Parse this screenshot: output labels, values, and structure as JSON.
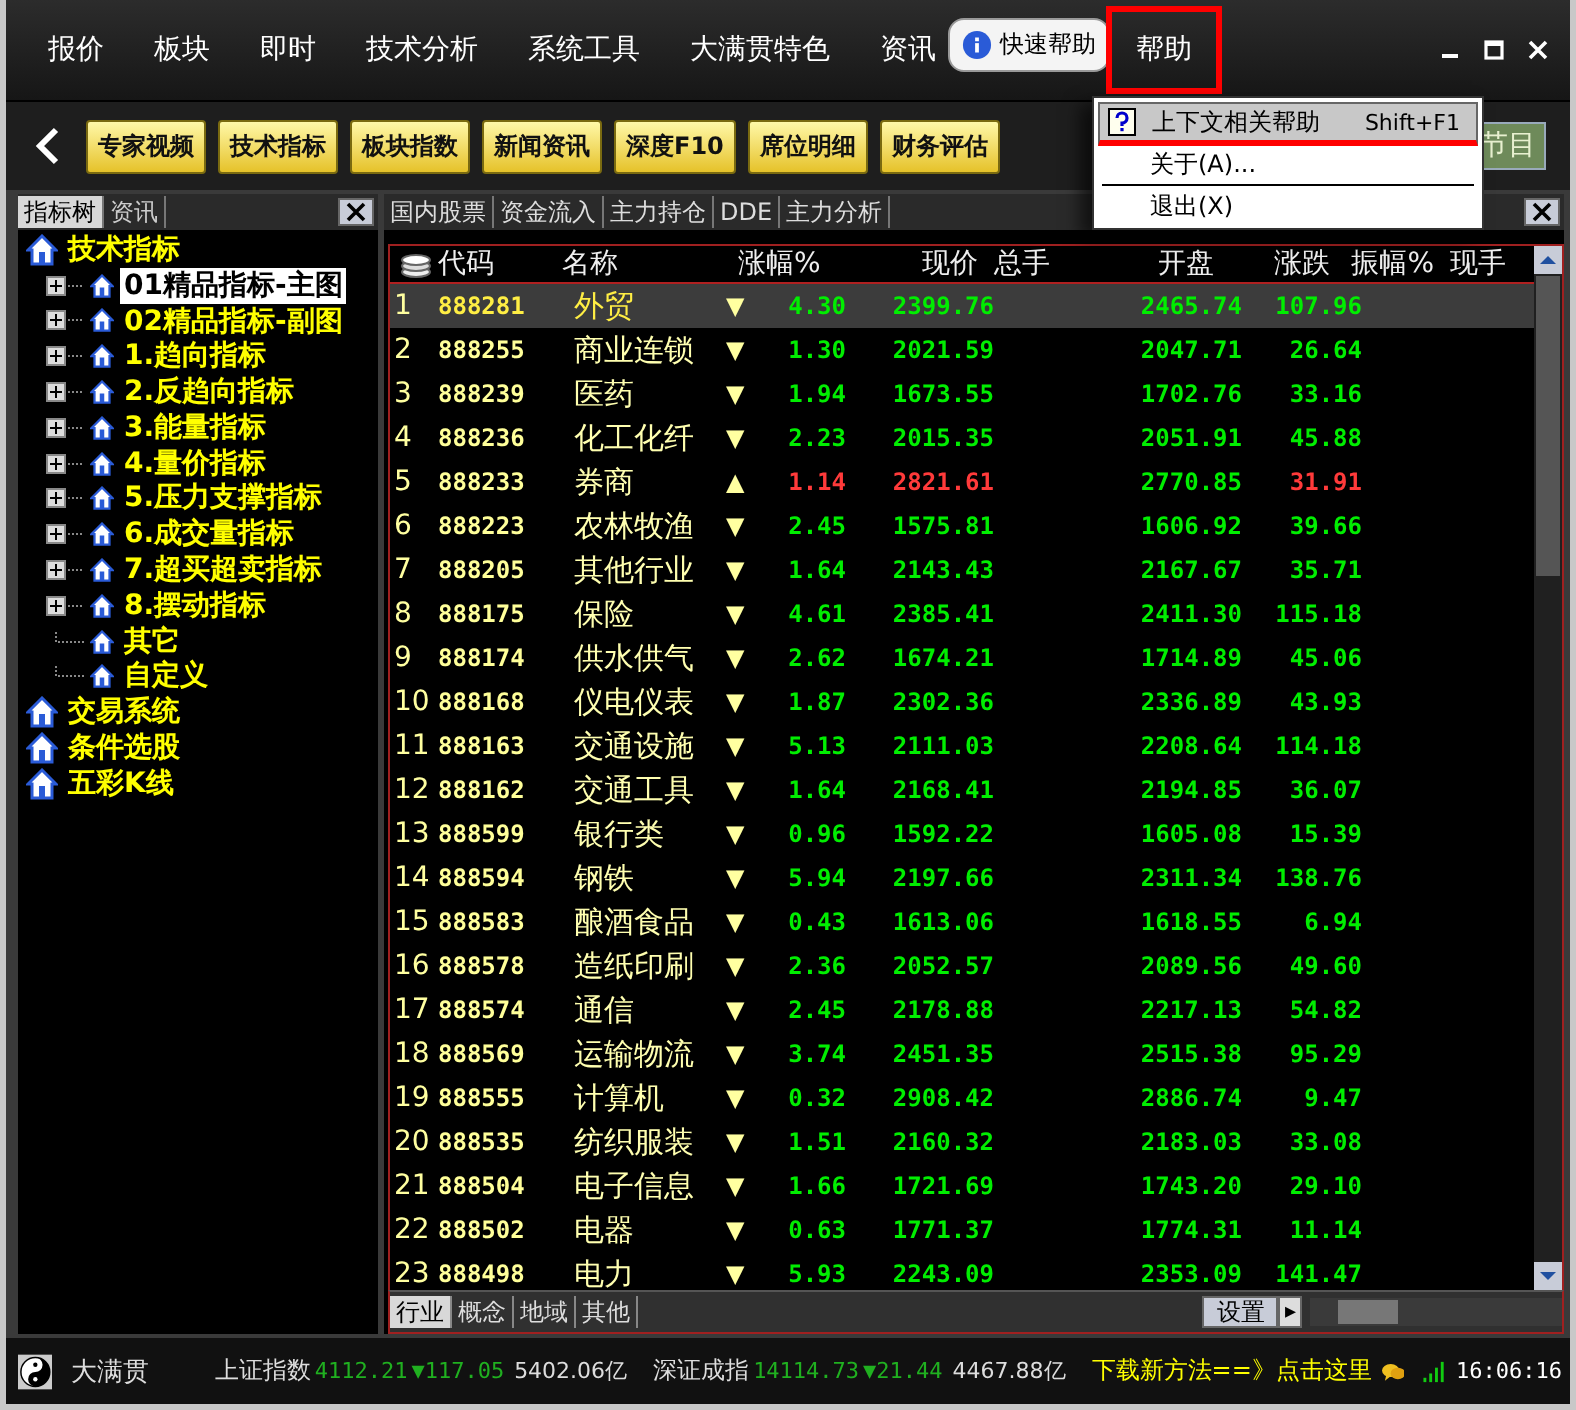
{
  "menu_bar": {
    "items": [
      {
        "label": "报价",
        "selected": false
      },
      {
        "label": "板块",
        "selected": false
      },
      {
        "label": "即时",
        "selected": false
      },
      {
        "label": "技术分析",
        "selected": false
      },
      {
        "label": "系统工具",
        "selected": false
      },
      {
        "label": "大满贯特色",
        "selected": false
      },
      {
        "label": "资讯",
        "selected": false
      },
      {
        "label": "帮助",
        "selected": true
      }
    ],
    "tooltip": "快速帮助"
  },
  "toolbar": {
    "buttons": [
      "专家视频",
      "技术指标",
      "板块指数",
      "新闻资讯",
      "深度F10",
      "席位明细",
      "财务评估"
    ],
    "extra_button": "节目"
  },
  "help_menu": {
    "items": [
      {
        "kind": "item",
        "label": "上下文相关帮助",
        "shortcut": "Shift+F1",
        "selected": true
      },
      {
        "kind": "item",
        "label": "关于(A)...",
        "selected": false
      },
      {
        "kind": "separator"
      },
      {
        "kind": "item",
        "label": "退出(X)",
        "selected": false
      }
    ]
  },
  "left_panel": {
    "tabs": [
      {
        "label": "指标树",
        "selected": true
      },
      {
        "label": "资讯",
        "selected": false
      }
    ],
    "tree": [
      {
        "label": "技术指标",
        "selected": false,
        "children": [
          {
            "label": "01精品指标-主图",
            "selected": true,
            "expanded": false
          },
          {
            "label": "02精品指标-副图",
            "selected": false,
            "expanded": false
          },
          {
            "label": "1.趋向指标",
            "selected": false,
            "expanded": false
          },
          {
            "label": "2.反趋向指标",
            "selected": false,
            "expanded": false
          },
          {
            "label": "3.能量指标",
            "selected": false,
            "expanded": false
          },
          {
            "label": "4.量价指标",
            "selected": false,
            "expanded": false
          },
          {
            "label": "5.压力支撑指标",
            "selected": false,
            "expanded": false
          },
          {
            "label": "6.成交量指标",
            "selected": false,
            "expanded": false
          },
          {
            "label": "7.超买超卖指标",
            "selected": false,
            "expanded": false
          },
          {
            "label": "8.摆动指标",
            "selected": false,
            "expanded": false
          },
          {
            "label": "其它",
            "selected": false
          },
          {
            "label": "自定义",
            "selected": false
          }
        ]
      },
      {
        "label": "交易系统",
        "selected": false
      },
      {
        "label": "条件选股",
        "selected": false
      },
      {
        "label": "五彩K线",
        "selected": false
      }
    ]
  },
  "right_panel": {
    "tabs": [
      "国内股票",
      "资金流入",
      "主力持仓",
      "DDE",
      "主力分析"
    ],
    "table": {
      "columns": [
        "代码",
        "名称",
        "涨幅%",
        "现价",
        "总手",
        "开盘",
        "涨跌",
        "振幅%",
        "现手"
      ],
      "rows": [
        {
          "no": "1",
          "code": "888281",
          "name": "外贸",
          "arrow": "▼",
          "change_pct": "4.30",
          "price": "2399.76",
          "open": "2465.74",
          "change": "107.96",
          "color": "#00ee00",
          "selected": true
        },
        {
          "no": "2",
          "code": "888255",
          "name": "商业连锁",
          "arrow": "▼",
          "change_pct": "1.30",
          "price": "2021.59",
          "open": "2047.71",
          "change": "26.64",
          "color": "#00ee00",
          "selected": false
        },
        {
          "no": "3",
          "code": "888239",
          "name": "医药",
          "arrow": "▼",
          "change_pct": "1.94",
          "price": "1673.55",
          "open": "1702.76",
          "change": "33.16",
          "color": "#00ee00",
          "selected": false
        },
        {
          "no": "4",
          "code": "888236",
          "name": "化工化纤",
          "arrow": "▼",
          "change_pct": "2.23",
          "price": "2015.35",
          "open": "2051.91",
          "change": "45.88",
          "color": "#00ee00",
          "selected": false
        },
        {
          "no": "5",
          "code": "888233",
          "name": "券商",
          "arrow": "▲",
          "change_pct": "1.14",
          "price": "2821.61",
          "open": "2770.85",
          "change": "31.91",
          "color": "#ff3a3a",
          "selected": false
        },
        {
          "no": "6",
          "code": "888223",
          "name": "农林牧渔",
          "arrow": "▼",
          "change_pct": "2.45",
          "price": "1575.81",
          "open": "1606.92",
          "change": "39.66",
          "color": "#00ee00",
          "selected": false
        },
        {
          "no": "7",
          "code": "888205",
          "name": "其他行业",
          "arrow": "▼",
          "change_pct": "1.64",
          "price": "2143.43",
          "open": "2167.67",
          "change": "35.71",
          "color": "#00ee00",
          "selected": false
        },
        {
          "no": "8",
          "code": "888175",
          "name": "保险",
          "arrow": "▼",
          "change_pct": "4.61",
          "price": "2385.41",
          "open": "2411.30",
          "change": "115.18",
          "color": "#00ee00",
          "selected": false
        },
        {
          "no": "9",
          "code": "888174",
          "name": "供水供气",
          "arrow": "▼",
          "change_pct": "2.62",
          "price": "1674.21",
          "open": "1714.89",
          "change": "45.06",
          "color": "#00ee00",
          "selected": false
        },
        {
          "no": "10",
          "code": "888168",
          "name": "仪电仪表",
          "arrow": "▼",
          "change_pct": "1.87",
          "price": "2302.36",
          "open": "2336.89",
          "change": "43.93",
          "color": "#00ee00",
          "selected": false
        },
        {
          "no": "11",
          "code": "888163",
          "name": "交通设施",
          "arrow": "▼",
          "change_pct": "5.13",
          "price": "2111.03",
          "open": "2208.64",
          "change": "114.18",
          "color": "#00ee00",
          "selected": false
        },
        {
          "no": "12",
          "code": "888162",
          "name": "交通工具",
          "arrow": "▼",
          "change_pct": "1.64",
          "price": "2168.41",
          "open": "2194.85",
          "change": "36.07",
          "color": "#00ee00",
          "selected": false
        },
        {
          "no": "13",
          "code": "888599",
          "name": "银行类",
          "arrow": "▼",
          "change_pct": "0.96",
          "price": "1592.22",
          "open": "1605.08",
          "change": "15.39",
          "color": "#00ee00",
          "selected": false
        },
        {
          "no": "14",
          "code": "888594",
          "name": "钢铁",
          "arrow": "▼",
          "change_pct": "5.94",
          "price": "2197.66",
          "open": "2311.34",
          "change": "138.76",
          "color": "#00ee00",
          "selected": false
        },
        {
          "no": "15",
          "code": "888583",
          "name": "酿酒食品",
          "arrow": "▼",
          "change_pct": "0.43",
          "price": "1613.06",
          "open": "1618.55",
          "change": "6.94",
          "color": "#00ee00",
          "selected": false
        },
        {
          "no": "16",
          "code": "888578",
          "name": "造纸印刷",
          "arrow": "▼",
          "change_pct": "2.36",
          "price": "2052.57",
          "open": "2089.56",
          "change": "49.60",
          "color": "#00ee00",
          "selected": false
        },
        {
          "no": "17",
          "code": "888574",
          "name": "通信",
          "arrow": "▼",
          "change_pct": "2.45",
          "price": "2178.88",
          "open": "2217.13",
          "change": "54.82",
          "color": "#00ee00",
          "selected": false
        },
        {
          "no": "18",
          "code": "888569",
          "name": "运输物流",
          "arrow": "▼",
          "change_pct": "3.74",
          "price": "2451.35",
          "open": "2515.38",
          "change": "95.29",
          "color": "#00ee00",
          "selected": false
        },
        {
          "no": "19",
          "code": "888555",
          "name": "计算机",
          "arrow": "▼",
          "change_pct": "0.32",
          "price": "2908.42",
          "open": "2886.74",
          "change": "9.47",
          "color": "#00ee00",
          "selected": false
        },
        {
          "no": "20",
          "code": "888535",
          "name": "纺织服装",
          "arrow": "▼",
          "change_pct": "1.51",
          "price": "2160.32",
          "open": "2183.03",
          "change": "33.08",
          "color": "#00ee00",
          "selected": false
        },
        {
          "no": "21",
          "code": "888504",
          "name": "电子信息",
          "arrow": "▼",
          "change_pct": "1.66",
          "price": "1721.69",
          "open": "1743.20",
          "change": "29.10",
          "color": "#00ee00",
          "selected": false
        },
        {
          "no": "22",
          "code": "888502",
          "name": "电器",
          "arrow": "▼",
          "change_pct": "0.63",
          "price": "1771.37",
          "open": "1774.31",
          "change": "11.14",
          "color": "#00ee00",
          "selected": false
        },
        {
          "no": "23",
          "code": "888498",
          "name": "电力",
          "arrow": "▼",
          "change_pct": "5.93",
          "price": "2243.09",
          "open": "2353.09",
          "change": "141.47",
          "color": "#00ee00",
          "selected": false
        }
      ]
    },
    "bottom_tabs": [
      {
        "label": "行业",
        "selected": true
      },
      {
        "label": "概念",
        "selected": false
      },
      {
        "label": "地域",
        "selected": false
      },
      {
        "label": "其他",
        "selected": false
      }
    ],
    "settings_button": "设置",
    "arrow_button": "▸"
  },
  "status_bar": {
    "app_name": "大满贯",
    "indices": [
      {
        "name": "上证指数",
        "value": "4112.21",
        "change": "▼117.05",
        "amount": "5402.06亿"
      },
      {
        "name": "深证成指",
        "value": "14114.73",
        "change": "▼21.44",
        "amount": "4467.88亿"
      }
    ],
    "ticker": "下载新方法==》点击这里",
    "time": "16:06:16"
  }
}
